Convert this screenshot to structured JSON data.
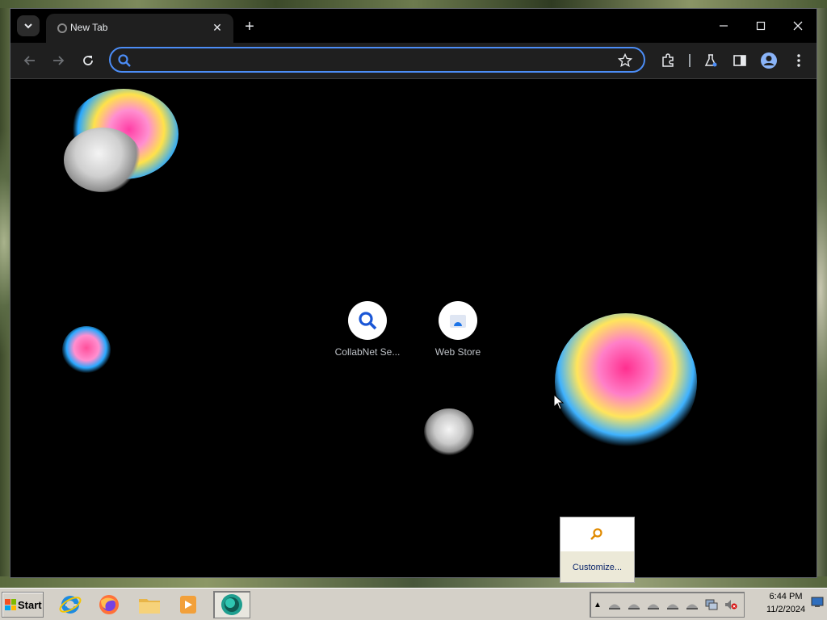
{
  "browser": {
    "tab": {
      "title": "New Tab"
    },
    "omnibox": {
      "value": "",
      "placeholder": ""
    },
    "shortcuts": [
      {
        "label": "CollabNet Se...",
        "icon": "search-icon"
      },
      {
        "label": "Web Store",
        "icon": "web-store-icon"
      }
    ],
    "accent_color": "#4c8df6"
  },
  "tray_popup": {
    "customize_label": "Customize..."
  },
  "taskbar": {
    "start_label": "Start",
    "apps": [
      {
        "name": "internet-explorer-icon"
      },
      {
        "name": "firefox-icon"
      },
      {
        "name": "file-explorer-icon"
      },
      {
        "name": "media-player-icon"
      },
      {
        "name": "chrome-icon",
        "active": true
      }
    ],
    "clock": {
      "time": "6:44 PM",
      "date": "11/2/2024"
    }
  }
}
